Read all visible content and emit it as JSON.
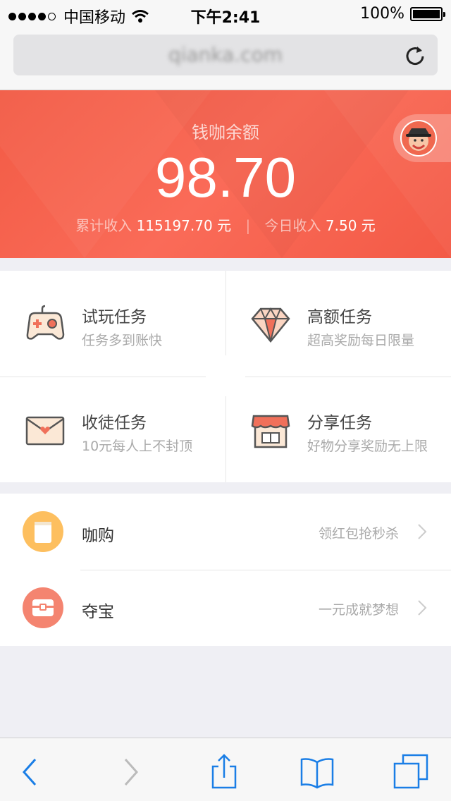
{
  "status_bar": {
    "carrier": "中国移动",
    "time": "下午2:41",
    "battery": "100%"
  },
  "browser": {
    "url": "qianka.com"
  },
  "balance": {
    "label": "钱咖余额",
    "amount": "98.70",
    "total_label": "累计收入",
    "total_value": "115197.70 元",
    "today_label": "今日收入",
    "today_value": "7.50 元"
  },
  "tasks": [
    {
      "title": "试玩任务",
      "subtitle": "任务多到账快",
      "icon": "gamepad-icon"
    },
    {
      "title": "高额任务",
      "subtitle": "超高奖励每日限量",
      "icon": "diamond-icon"
    },
    {
      "title": "收徒任务",
      "subtitle": "10元每人上不封顶",
      "icon": "envelope-icon"
    },
    {
      "title": "分享任务",
      "subtitle": "好物分享奖励无上限",
      "icon": "shop-icon"
    }
  ],
  "list": [
    {
      "label": "咖购",
      "hint": "领红包抢秒杀",
      "icon": "bag-icon",
      "color": "#fdbf5f"
    },
    {
      "label": "夺宝",
      "hint": "一元成就梦想",
      "icon": "treasure-icon",
      "color": "#f48470"
    }
  ],
  "colors": {
    "accent": "#f45c47",
    "blue": "#1a7ee6"
  }
}
